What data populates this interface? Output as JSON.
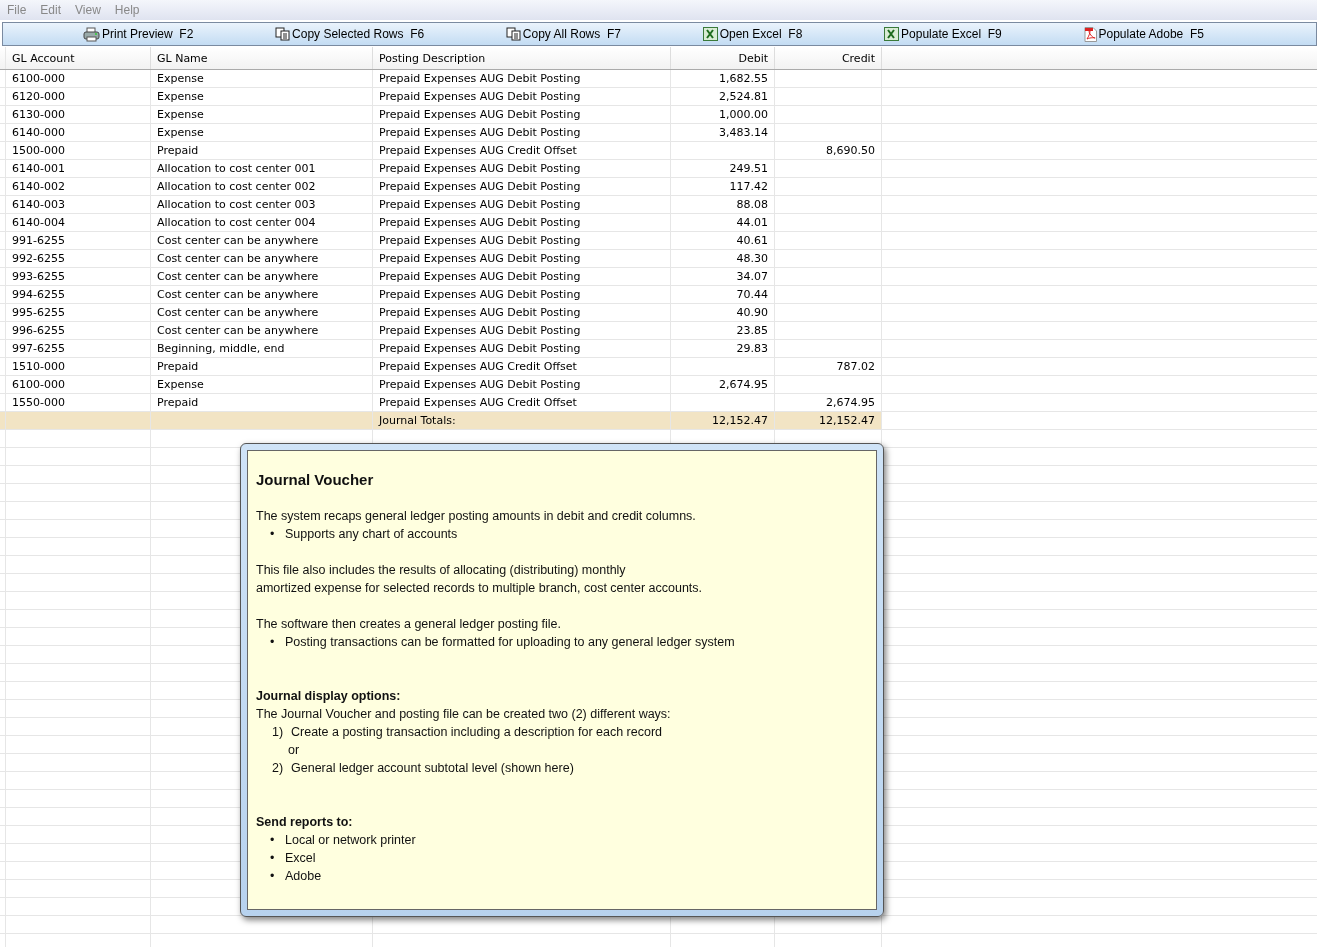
{
  "menu": [
    "File",
    "Edit",
    "View",
    "Help"
  ],
  "toolbar": [
    {
      "kind": "printer",
      "label": "Print Preview  F2"
    },
    {
      "kind": "copy",
      "label": "Copy Selected Rows  F6"
    },
    {
      "kind": "copy",
      "label": "Copy All Rows  F7"
    },
    {
      "kind": "excel",
      "label": "Open Excel  F8"
    },
    {
      "kind": "excel",
      "label": "Populate Excel  F9"
    },
    {
      "kind": "pdf",
      "label": "Populate Adobe  F5"
    }
  ],
  "table": {
    "columns": [
      "GL Account",
      "GL Name",
      "Posting Description",
      "Debit",
      "Credit"
    ],
    "rows": [
      [
        "6100-000",
        "Expense",
        "Prepaid Expenses AUG Debit Posting",
        "1,682.55",
        ""
      ],
      [
        "6120-000",
        "Expense",
        "Prepaid Expenses AUG Debit Posting",
        "2,524.81",
        ""
      ],
      [
        "6130-000",
        "Expense",
        "Prepaid Expenses AUG Debit Posting",
        "1,000.00",
        ""
      ],
      [
        "6140-000",
        "Expense",
        "Prepaid Expenses AUG Debit Posting",
        "3,483.14",
        ""
      ],
      [
        "1500-000",
        "Prepaid",
        "Prepaid Expenses AUG Credit Offset",
        "",
        "8,690.50"
      ],
      [
        "6140-001",
        "Allocation to cost center 001",
        "Prepaid Expenses AUG Debit Posting",
        "249.51",
        ""
      ],
      [
        "6140-002",
        "Allocation to cost center 002",
        "Prepaid Expenses AUG Debit Posting",
        "117.42",
        ""
      ],
      [
        "6140-003",
        "Allocation to cost center 003",
        "Prepaid Expenses AUG Debit Posting",
        "88.08",
        ""
      ],
      [
        "6140-004",
        "Allocation to cost center 004",
        "Prepaid Expenses AUG Debit Posting",
        "44.01",
        ""
      ],
      [
        "991-6255",
        "Cost center can be anywhere",
        "Prepaid Expenses AUG Debit Posting",
        "40.61",
        ""
      ],
      [
        "992-6255",
        "Cost center can be anywhere",
        "Prepaid Expenses AUG Debit Posting",
        "48.30",
        ""
      ],
      [
        "993-6255",
        "Cost center can be anywhere",
        "Prepaid Expenses AUG Debit Posting",
        "34.07",
        ""
      ],
      [
        "994-6255",
        "Cost center can be anywhere",
        "Prepaid Expenses AUG Debit Posting",
        "70.44",
        ""
      ],
      [
        "995-6255",
        "Cost center can be anywhere",
        "Prepaid Expenses AUG Debit Posting",
        "40.90",
        ""
      ],
      [
        "996-6255",
        "Cost center can be anywhere",
        "Prepaid Expenses AUG Debit Posting",
        "23.85",
        ""
      ],
      [
        "997-6255",
        "Beginning, middle, end",
        "Prepaid Expenses AUG Debit Posting",
        "29.83",
        ""
      ],
      [
        "1510-000",
        "Prepaid",
        "Prepaid Expenses AUG Credit Offset",
        "",
        "787.02"
      ],
      [
        "6100-000",
        "Expense",
        "Prepaid Expenses AUG Debit Posting",
        "2,674.95",
        ""
      ],
      [
        "1550-000",
        "Prepaid",
        "Prepaid Expenses AUG Credit Offset",
        "",
        "2,674.95"
      ]
    ],
    "totals": {
      "label": "Journal Totals:",
      "debit": "12,152.47",
      "credit": "12,152.47"
    }
  },
  "popup": {
    "title": "Journal Voucher",
    "sections": [
      {
        "lines": [
          {
            "kind": "text",
            "text": "The system recaps general ledger posting amounts in debit and credit columns."
          },
          {
            "kind": "bullet",
            "marker": "•",
            "text": "Supports any chart of accounts"
          }
        ]
      },
      {
        "lines": [
          {
            "kind": "text",
            "text": "This file also includes the results of allocating (distributing) monthly"
          },
          {
            "kind": "text",
            "text": "amortized expense for selected records to multiple branch, cost center accounts."
          }
        ]
      },
      {
        "lines": [
          {
            "kind": "text",
            "text": "The software then creates a general ledger posting file."
          },
          {
            "kind": "bullet",
            "marker": "•",
            "text": "Posting transactions can be formatted for uploading to any general ledger system"
          }
        ]
      },
      {
        "lines": [
          {
            "kind": "heading",
            "text": "Journal display options:"
          },
          {
            "kind": "text",
            "text": "The Journal Voucher and posting file can be created two (2) different ways:"
          },
          {
            "kind": "numbered",
            "marker": "1)",
            "text": "Create a posting transaction including a description for each record"
          },
          {
            "kind": "indent",
            "text": "or"
          },
          {
            "kind": "numbered",
            "marker": "2)",
            "text": "General ledger account subtotal level (shown here)"
          }
        ]
      },
      {
        "lines": [
          {
            "kind": "heading",
            "text": "Send reports to:"
          },
          {
            "kind": "bullet",
            "marker": "•",
            "text": "Local or network printer"
          },
          {
            "kind": "bullet",
            "marker": "•",
            "text": "Excel"
          },
          {
            "kind": "bullet",
            "marker": "•",
            "text": "Adobe"
          }
        ]
      }
    ]
  }
}
